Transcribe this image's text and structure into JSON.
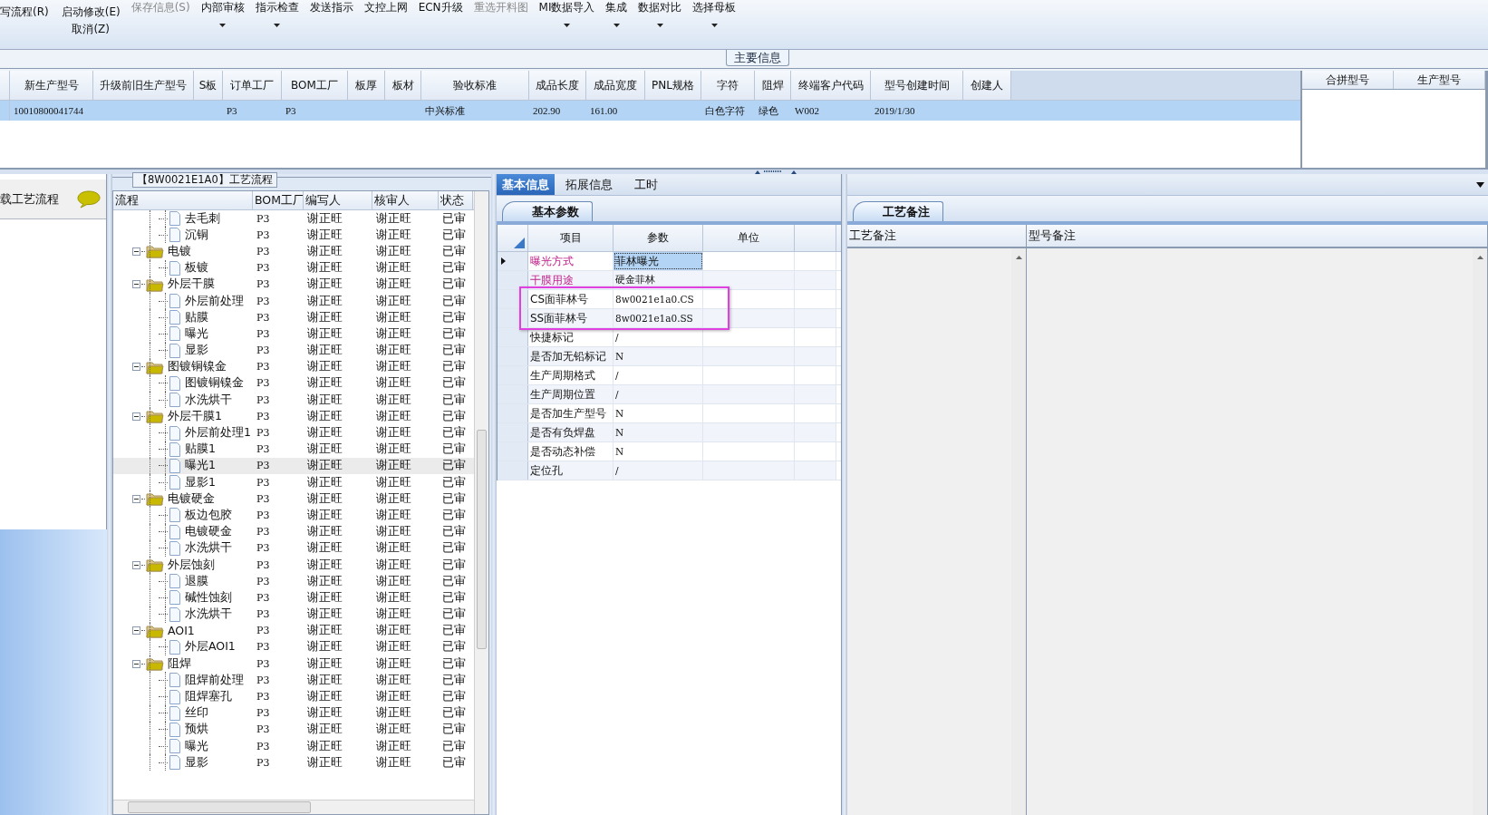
{
  "toolbar": {
    "left_buttons": [
      {
        "label": "写流程(R)"
      },
      {
        "label": "启动修改(E)"
      },
      {
        "label": "取消(Z)"
      }
    ],
    "buttons": [
      {
        "label": "保存信息(S)",
        "disabled": true,
        "dropdown": false
      },
      {
        "label": "内部审核",
        "disabled": false,
        "dropdown": true
      },
      {
        "label": "指示检查",
        "disabled": false,
        "dropdown": true
      },
      {
        "label": "发送指示",
        "disabled": false,
        "dropdown": false
      },
      {
        "label": "文控上网",
        "disabled": false,
        "dropdown": false
      },
      {
        "label": "ECN升级",
        "disabled": false,
        "dropdown": false
      },
      {
        "label": "重选开料图",
        "disabled": true,
        "dropdown": false
      },
      {
        "label": "MI数据导入",
        "disabled": false,
        "dropdown": true
      },
      {
        "label": "集成",
        "disabled": false,
        "dropdown": true
      },
      {
        "label": "数据对比",
        "disabled": false,
        "dropdown": true
      },
      {
        "label": "选择母板",
        "disabled": false,
        "dropdown": true
      }
    ]
  },
  "main_info": {
    "title": "主要信息",
    "columns": [
      "新生产型号",
      "升级前旧生产型号",
      "S板",
      "订单工厂",
      "BOM工厂",
      "板厚",
      "板材",
      "验收标准",
      "成品长度",
      "成品宽度",
      "PNL规格",
      "字符",
      "阻焊",
      "终端客户代码",
      "型号创建时间",
      "创建人"
    ],
    "rows": [
      {
        "selected": true,
        "cells": [
          "10010800041744",
          null,
          null,
          "P3",
          "P3",
          null,
          null,
          "中兴标准",
          "202.90",
          "161.00",
          null,
          "白色字符",
          "绿色",
          "W002",
          "2019/1/30",
          null
        ]
      }
    ],
    "merge_columns": [
      "合拼型号",
      "生产型号"
    ]
  },
  "left_panel": {
    "button": "载工艺流程"
  },
  "process_flow": {
    "title": "【8W0021E1A0】工艺流程",
    "columns": [
      "流程",
      "BOM工厂",
      "编写人",
      "核审人",
      "状态"
    ],
    "rows": [
      {
        "kind": "fragment",
        "children": [
          {
            "kind": "leaf",
            "label": "去毛刺",
            "bom": "P3",
            "writer": "谢正旺",
            "reviewer": "谢正旺",
            "status": "已审",
            "selected": false
          },
          {
            "kind": "leaf",
            "label": "沉铜",
            "bom": "P3",
            "writer": "谢正旺",
            "reviewer": "谢正旺",
            "status": "已审",
            "selected": false
          }
        ]
      },
      {
        "kind": "folder",
        "expanded": true,
        "label": "电镀",
        "bom": "P3",
        "writer": "谢正旺",
        "reviewer": "谢正旺",
        "status": "已审",
        "selected": false,
        "children": [
          {
            "kind": "leaf",
            "label": "板镀",
            "bom": "P3",
            "writer": "谢正旺",
            "reviewer": "谢正旺",
            "status": "已审",
            "selected": false
          }
        ]
      },
      {
        "kind": "folder",
        "expanded": true,
        "label": "外层干膜",
        "bom": "P3",
        "writer": "谢正旺",
        "reviewer": "谢正旺",
        "status": "已审",
        "selected": false,
        "children": [
          {
            "kind": "leaf",
            "label": "外层前处理",
            "bom": "P3",
            "writer": "谢正旺",
            "reviewer": "谢正旺",
            "status": "已审",
            "selected": false
          },
          {
            "kind": "leaf",
            "label": "贴膜",
            "bom": "P3",
            "writer": "谢正旺",
            "reviewer": "谢正旺",
            "status": "已审",
            "selected": false
          },
          {
            "kind": "leaf",
            "label": "曝光",
            "bom": "P3",
            "writer": "谢正旺",
            "reviewer": "谢正旺",
            "status": "已审",
            "selected": false
          },
          {
            "kind": "leaf",
            "label": "显影",
            "bom": "P3",
            "writer": "谢正旺",
            "reviewer": "谢正旺",
            "status": "已审",
            "selected": false
          }
        ]
      },
      {
        "kind": "folder",
        "expanded": true,
        "label": "图镀铜镍金",
        "bom": "P3",
        "writer": "谢正旺",
        "reviewer": "谢正旺",
        "status": "已审",
        "selected": false,
        "children": [
          {
            "kind": "leaf",
            "label": "图镀铜镍金",
            "bom": "P3",
            "writer": "谢正旺",
            "reviewer": "谢正旺",
            "status": "已审",
            "selected": false
          },
          {
            "kind": "leaf",
            "label": "水洗烘干",
            "bom": "P3",
            "writer": "谢正旺",
            "reviewer": "谢正旺",
            "status": "已审",
            "selected": false
          }
        ]
      },
      {
        "kind": "folder",
        "expanded": true,
        "label": "外层干膜1",
        "bom": "P3",
        "writer": "谢正旺",
        "reviewer": "谢正旺",
        "status": "已审",
        "selected": false,
        "children": [
          {
            "kind": "leaf",
            "label": "外层前处理1",
            "bom": "P3",
            "writer": "谢正旺",
            "reviewer": "谢正旺",
            "status": "已审",
            "selected": false
          },
          {
            "kind": "leaf",
            "label": "贴膜1",
            "bom": "P3",
            "writer": "谢正旺",
            "reviewer": "谢正旺",
            "status": "已审",
            "selected": false
          },
          {
            "kind": "leaf",
            "label": "曝光1",
            "bom": "P3",
            "writer": "谢正旺",
            "reviewer": "谢正旺",
            "status": "已审",
            "selected": true
          },
          {
            "kind": "leaf",
            "label": "显影1",
            "bom": "P3",
            "writer": "谢正旺",
            "reviewer": "谢正旺",
            "status": "已审",
            "selected": false
          }
        ]
      },
      {
        "kind": "folder",
        "expanded": true,
        "label": "电镀硬金",
        "bom": "P3",
        "writer": "谢正旺",
        "reviewer": "谢正旺",
        "status": "已审",
        "selected": false,
        "children": [
          {
            "kind": "leaf",
            "label": "板边包胶",
            "bom": "P3",
            "writer": "谢正旺",
            "reviewer": "谢正旺",
            "status": "已审",
            "selected": false
          },
          {
            "kind": "leaf",
            "label": "电镀硬金",
            "bom": "P3",
            "writer": "谢正旺",
            "reviewer": "谢正旺",
            "status": "已审",
            "selected": false
          },
          {
            "kind": "leaf",
            "label": "水洗烘干",
            "bom": "P3",
            "writer": "谢正旺",
            "reviewer": "谢正旺",
            "status": "已审",
            "selected": false
          }
        ]
      },
      {
        "kind": "folder",
        "expanded": true,
        "label": "外层蚀刻",
        "bom": "P3",
        "writer": "谢正旺",
        "reviewer": "谢正旺",
        "status": "已审",
        "selected": false,
        "children": [
          {
            "kind": "leaf",
            "label": "退膜",
            "bom": "P3",
            "writer": "谢正旺",
            "reviewer": "谢正旺",
            "status": "已审",
            "selected": false
          },
          {
            "kind": "leaf",
            "label": "碱性蚀刻",
            "bom": "P3",
            "writer": "谢正旺",
            "reviewer": "谢正旺",
            "status": "已审",
            "selected": false
          },
          {
            "kind": "leaf",
            "label": "水洗烘干",
            "bom": "P3",
            "writer": "谢正旺",
            "reviewer": "谢正旺",
            "status": "已审",
            "selected": false
          }
        ]
      },
      {
        "kind": "folder",
        "expanded": true,
        "label": "AOI1",
        "bom": "P3",
        "writer": "谢正旺",
        "reviewer": "谢正旺",
        "status": "已审",
        "selected": false,
        "children": [
          {
            "kind": "leaf",
            "label": "外层AOI1",
            "bom": "P3",
            "writer": "谢正旺",
            "reviewer": "谢正旺",
            "status": "已审",
            "selected": false
          }
        ]
      },
      {
        "kind": "folder",
        "expanded": true,
        "label": "阻焊",
        "bom": "P3",
        "writer": "谢正旺",
        "reviewer": "谢正旺",
        "status": "已审",
        "selected": false,
        "children": [
          {
            "kind": "leaf",
            "label": "阻焊前处理",
            "bom": "P3",
            "writer": "谢正旺",
            "reviewer": "谢正旺",
            "status": "已审",
            "selected": false
          },
          {
            "kind": "leaf",
            "label": "阻焊塞孔",
            "bom": "P3",
            "writer": "谢正旺",
            "reviewer": "谢正旺",
            "status": "已审",
            "selected": false
          },
          {
            "kind": "leaf",
            "label": "丝印",
            "bom": "P3",
            "writer": "谢正旺",
            "reviewer": "谢正旺",
            "status": "已审",
            "selected": false
          },
          {
            "kind": "leaf",
            "label": "预烘",
            "bom": "P3",
            "writer": "谢正旺",
            "reviewer": "谢正旺",
            "status": "已审",
            "selected": false
          },
          {
            "kind": "leaf",
            "label": "曝光",
            "bom": "P3",
            "writer": "谢正旺",
            "reviewer": "谢正旺",
            "status": "已审",
            "selected": false
          },
          {
            "kind": "leaf",
            "label": "显影",
            "bom": "P3",
            "writer": "谢正旺",
            "reviewer": "谢正旺",
            "status": "已审",
            "selected": false
          }
        ]
      }
    ]
  },
  "detail": {
    "tabs": [
      {
        "label": "基本信息",
        "selected": true
      },
      {
        "label": "拓展信息",
        "selected": false
      },
      {
        "label": "工时",
        "selected": false
      }
    ],
    "subtab": "基本参数",
    "columns": [
      "项目",
      "参数",
      "单位"
    ],
    "rows": [
      {
        "item": "曝光方式",
        "value": "菲林曝光",
        "emphasis": true,
        "selected": true,
        "annotated": false
      },
      {
        "item": "干膜用途",
        "value": "硬金菲林",
        "emphasis": true,
        "selected": false,
        "annotated": false
      },
      {
        "item": "CS面菲林号",
        "value": "8w0021e1a0.CS",
        "emphasis": false,
        "selected": false,
        "annotated": true
      },
      {
        "item": "SS面菲林号",
        "value": "8w0021e1a0.SS",
        "emphasis": false,
        "selected": false,
        "annotated": true
      },
      {
        "item": "快捷标记",
        "value": "/",
        "emphasis": false,
        "selected": false,
        "annotated": false
      },
      {
        "item": "是否加无铅标记",
        "value": "N",
        "emphasis": false,
        "selected": false,
        "annotated": false
      },
      {
        "item": "生产周期格式",
        "value": "/",
        "emphasis": false,
        "selected": false,
        "annotated": false
      },
      {
        "item": "生产周期位置",
        "value": "/",
        "emphasis": false,
        "selected": false,
        "annotated": false
      },
      {
        "item": "是否加生产型号",
        "value": "N",
        "emphasis": false,
        "selected": false,
        "annotated": false
      },
      {
        "item": "是否有负焊盘",
        "value": "N",
        "emphasis": false,
        "selected": false,
        "annotated": false
      },
      {
        "item": "是否动态补偿",
        "value": "N",
        "emphasis": false,
        "selected": false,
        "annotated": false
      },
      {
        "item": "定位孔",
        "value": "/",
        "emphasis": false,
        "selected": false,
        "annotated": false
      }
    ]
  },
  "notes": {
    "subtab": "工艺备注",
    "columns": [
      "工艺备注",
      "型号备注"
    ]
  }
}
